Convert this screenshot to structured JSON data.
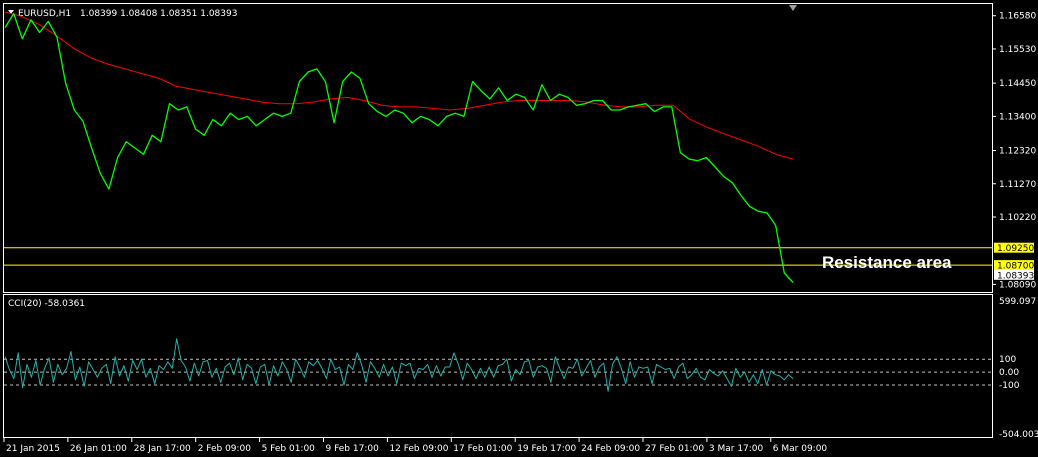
{
  "main_header": {
    "symbol": "EURUSD,H1",
    "ohlc": "1.08399 1.08408 1.08351 1.08393"
  },
  "cci_header": {
    "label": "CCI(20) -58.0361"
  },
  "colors": {
    "background": "#000000",
    "price": "#00ff00",
    "moving_average": "#ff0000",
    "cci": "#20b2aa",
    "level_line": "#ffff00",
    "level_tag": "#ffff00",
    "current_tag": "#ffffff",
    "frame": "#ffffff"
  },
  "annotation": {
    "text": "Resistance area"
  },
  "chart_data": [
    {
      "type": "line",
      "pane": "price",
      "ylim": [
        1.0785,
        1.1695
      ],
      "price_ticks": [
        "1.16580",
        "1.15530",
        "1.14450",
        "1.13400",
        "1.12320",
        "1.11270",
        "1.10220",
        "1.08090"
      ],
      "level_tags": [
        "1.09250",
        "1.08700"
      ],
      "current_tag": "1.08393",
      "levels": [
        1.0925,
        1.087
      ],
      "x_labels": [
        "21 Jan 2015",
        "26 Jan 01:00",
        "28 Jan 17:00",
        "2 Feb 09:00",
        "5 Feb 01:00",
        "9 Feb 17:00",
        "12 Feb 09:00",
        "17 Feb 01:00",
        "19 Feb 17:00",
        "24 Feb 09:00",
        "27 Feb 01:00",
        "3 Mar 17:00",
        "6 Mar 09:00"
      ],
      "series": [
        {
          "values": [
            1.162,
            1.1665,
            1.1585,
            1.1645,
            1.1605,
            1.164,
            1.159,
            1.1445,
            1.136,
            1.1325,
            1.124,
            1.116,
            1.111,
            1.121,
            1.126,
            1.124,
            1.122,
            1.128,
            1.126,
            1.138,
            1.136,
            1.137,
            1.13,
            1.128,
            1.133,
            1.131,
            1.135,
            1.133,
            1.134,
            1.131,
            1.133,
            1.135,
            1.134,
            1.135,
            1.145,
            1.148,
            1.149,
            1.145,
            1.132,
            1.145,
            1.148,
            1.146,
            1.138,
            1.1355,
            1.134,
            1.136,
            1.135,
            1.132,
            1.134,
            1.133,
            1.131,
            1.134,
            1.135,
            1.134,
            1.145,
            1.142,
            1.1395,
            1.143,
            1.139,
            1.141,
            1.14,
            1.136,
            1.144,
            1.139,
            1.141,
            1.14,
            1.1375,
            1.138,
            1.139,
            1.139,
            1.136,
            1.136,
            1.137,
            1.1375,
            1.138,
            1.1355,
            1.137,
            1.137,
            1.1225,
            1.1205,
            1.12,
            1.121,
            1.118,
            1.115,
            1.113,
            1.109,
            1.1055,
            1.104,
            1.1035,
            1.0995,
            1.0845,
            1.0815
          ]
        },
        {
          "values": [
            1.167,
            1.1655,
            1.163,
            1.1595,
            1.1555,
            1.1525,
            1.1505,
            1.149,
            1.1475,
            1.146,
            1.1435,
            1.1425,
            1.1415,
            1.1405,
            1.1395,
            1.1385,
            1.138,
            1.138,
            1.1385,
            1.1395,
            1.14,
            1.139,
            1.1375,
            1.137,
            1.137,
            1.1365,
            1.136,
            1.1365,
            1.1375,
            1.1385,
            1.139,
            1.139,
            1.139,
            1.139,
            1.1385,
            1.1375,
            1.137,
            1.137,
            1.1375,
            1.1375,
            1.133,
            1.1305,
            1.1285,
            1.1265,
            1.1245,
            1.122,
            1.1205
          ]
        }
      ]
    },
    {
      "type": "line",
      "pane": "cci",
      "ylim": [
        -504.003,
        599.097
      ],
      "ticks": [
        "599.097",
        "100",
        "0.00",
        "-100",
        "-504.003"
      ],
      "levels": [
        100,
        0,
        -100
      ],
      "series": [
        {
          "values": [
            120,
            20,
            -50,
            150,
            -120,
            60,
            -40,
            90,
            -100,
            30,
            110,
            -80,
            60,
            -20,
            30,
            160,
            -60,
            40,
            -110,
            80,
            20,
            -40,
            30,
            60,
            -90,
            120,
            -30,
            50,
            -70,
            90,
            20,
            100,
            -40,
            30,
            -90,
            50,
            20,
            80,
            30,
            260,
            90,
            40,
            -70,
            70,
            -30,
            80,
            90,
            -40,
            30,
            -80,
            40,
            70,
            -20,
            110,
            -60,
            60,
            30,
            -90,
            40,
            60,
            -100,
            50,
            -30,
            80,
            20,
            -80,
            100,
            40,
            -40,
            80,
            50,
            90,
            30,
            -50,
            100,
            20,
            40,
            -100,
            60,
            20,
            150,
            60,
            -80,
            80,
            30,
            -40,
            60,
            -30,
            40,
            -90,
            70,
            50,
            70,
            -50,
            30,
            20,
            60,
            -40,
            50,
            -30,
            40,
            40,
            150,
            60,
            -60,
            70,
            20,
            -50,
            30,
            -40,
            40,
            -40,
            50,
            60,
            100,
            -70,
            20,
            -20,
            80,
            90,
            -40,
            40,
            50,
            30,
            -80,
            120,
            30,
            -50,
            40,
            30,
            100,
            -30,
            30,
            90,
            -40,
            40,
            70,
            -150,
            60,
            120,
            30,
            -90,
            80,
            -40,
            40,
            30,
            40,
            -90,
            60,
            40,
            20,
            30,
            -50,
            40,
            70,
            -50,
            -20,
            30,
            -40,
            -60,
            20,
            -10,
            -30,
            10,
            -50,
            -110,
            30,
            -40,
            0,
            -80,
            -20,
            -90,
            20,
            -100,
            10,
            -20,
            -30,
            -60,
            -20,
            -50
          ]
        }
      ]
    }
  ]
}
